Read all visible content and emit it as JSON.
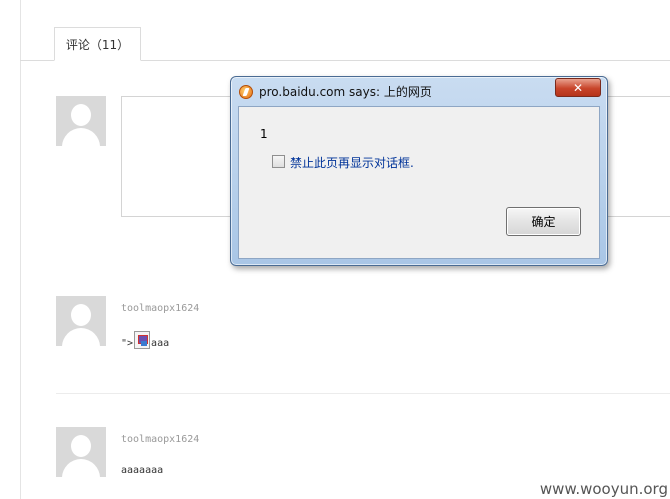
{
  "tab": {
    "label": "评论（11）"
  },
  "comments": [
    {
      "user": "toolmaopx1624",
      "text_prefix": "\">",
      "text_suffix": "aaa"
    },
    {
      "user": "toolmaopx1624",
      "text": "aaaaaaa"
    }
  ],
  "dialog": {
    "title": "pro.baidu.com says: 上的网页",
    "close": "✕",
    "message": "1",
    "checkbox_label": "禁止此页再显示对话框.",
    "ok_label": "确定"
  },
  "watermark": "www.wooyun.org"
}
